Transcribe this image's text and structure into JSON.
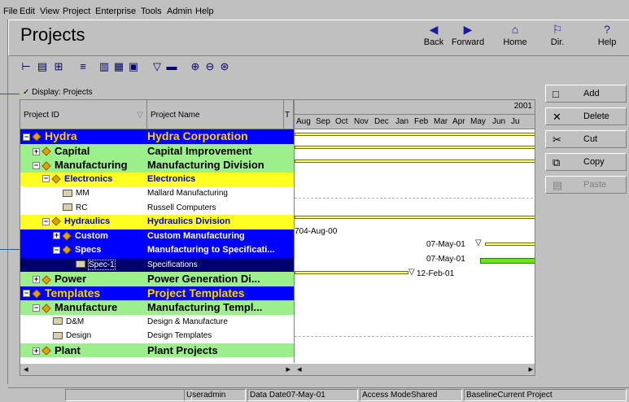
{
  "menu": [
    "File",
    "Edit",
    "View",
    "Project",
    "Enterprise",
    "Tools",
    "Admin",
    "Help"
  ],
  "page_title": "Projects",
  "nav": {
    "back": "Back",
    "forward": "Forward",
    "home": "Home",
    "dir": "Dir.",
    "help": "Help"
  },
  "display_label": "Display: Projects",
  "columns": {
    "id": "Project ID",
    "name": "Project Name",
    "year": "2001",
    "months": [
      "Aug",
      "Sep",
      "Oct",
      "Nov",
      "Dec",
      "Jan",
      "Feb",
      "Mar",
      "Apr",
      "May",
      "Jun",
      "Ju"
    ]
  },
  "rows": [
    {
      "id": "Hydra",
      "name": "Hydra Corporation"
    },
    {
      "id": "Capital",
      "name": "Capital Improvement"
    },
    {
      "id": "Manufacturing",
      "name": "Manufacturing Division"
    },
    {
      "id": "Electronics",
      "name": "Electronics"
    },
    {
      "id": "MM",
      "name": "Mallard Manufacturing"
    },
    {
      "id": "RC",
      "name": "Russell Computers"
    },
    {
      "id": "Hydraulics",
      "name": "Hydraulics Division"
    },
    {
      "id": "Custom",
      "name": "Custom Manufacturing"
    },
    {
      "id": "Specs",
      "name": "Manufacturing to Specificati..."
    },
    {
      "id": "Spec-1",
      "name": "Specifications"
    },
    {
      "id": "Power",
      "name": "Power Generation Di..."
    },
    {
      "id": "Templates",
      "name": "Project Templates"
    },
    {
      "id": "Manufacture",
      "name": "Manufacturing Templ..."
    },
    {
      "id": "D&M",
      "name": "Design & Manufacture"
    },
    {
      "id": "Design",
      "name": "Design Templates"
    },
    {
      "id": "Plant",
      "name": "Plant Projects"
    }
  ],
  "gantt_labels": {
    "custom": "704-Aug-00",
    "specs": "07-May-01",
    "spec1": "07-May-01",
    "power": "12-Feb-01"
  },
  "side_buttons": {
    "add": "Add",
    "delete": "Delete",
    "cut": "Cut",
    "copy": "Copy",
    "paste": "Paste"
  },
  "status": {
    "user": "Useradmin",
    "data_date": "Data Date07-May-01",
    "access": "Access ModeShared",
    "baseline": "BaselineCurrent Project"
  }
}
